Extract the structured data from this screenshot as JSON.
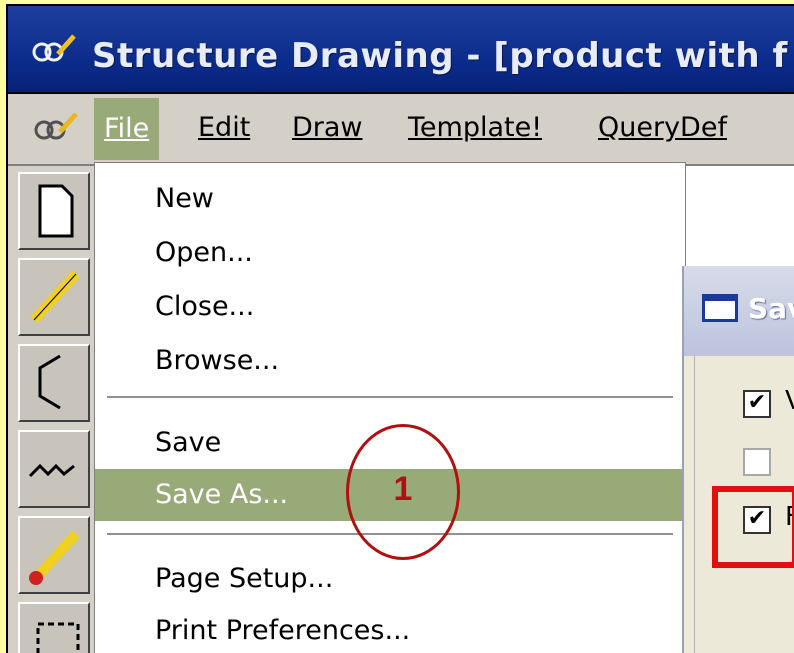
{
  "window": {
    "title": "Structure Drawing - [product with f",
    "icon": "app-icon"
  },
  "menubar": {
    "items": [
      {
        "label": "File",
        "active": true
      },
      {
        "label": "Edit"
      },
      {
        "label": "Draw"
      },
      {
        "label": "Template!"
      },
      {
        "label": "QueryDef"
      }
    ]
  },
  "file_menu": {
    "items": [
      {
        "label": "New"
      },
      {
        "label": "Open..."
      },
      {
        "label": "Close..."
      },
      {
        "label": "Browse..."
      },
      {
        "label": "Save"
      },
      {
        "label": "Save As...",
        "highlighted": true
      },
      {
        "label": "Page Setup..."
      },
      {
        "label": "Print Preferences..."
      }
    ]
  },
  "dialog": {
    "title": "Sav",
    "options": [
      {
        "label": "V",
        "checked": true,
        "enabled": true
      },
      {
        "label": "",
        "checked": false,
        "enabled": false
      },
      {
        "label": "F",
        "checked": true,
        "enabled": true,
        "highlighted": true
      }
    ]
  },
  "annotation": {
    "step_number": "1"
  },
  "colors": {
    "background": "#fffea0",
    "titlebar": "#0a2a8a",
    "menu_highlight": "#98aa78",
    "annotation": "#b01010",
    "highlight_box": "#e01010"
  }
}
